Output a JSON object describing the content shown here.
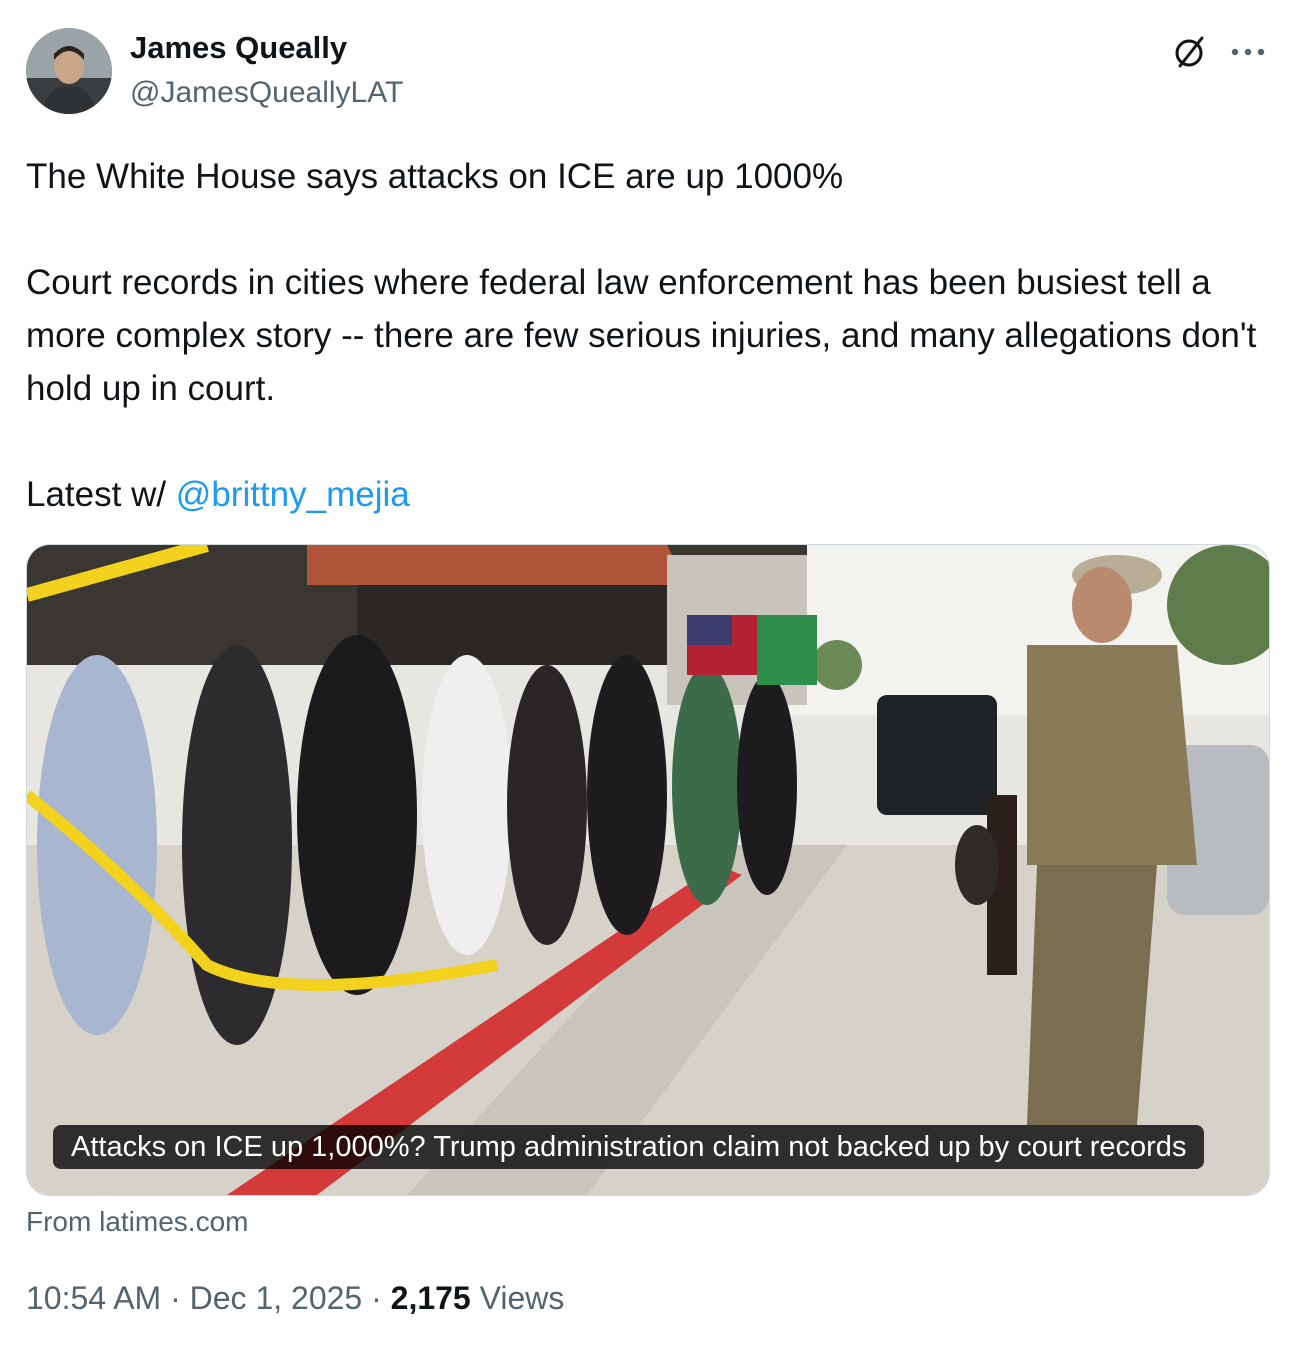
{
  "author": {
    "name": "James Queally",
    "handle": "@JamesQueallyLAT",
    "avatar_icon": "avatar-photo"
  },
  "header_icons": [
    "grok-icon",
    "more-icon"
  ],
  "tweet": {
    "line1": "The White House says attacks on ICE are up 1000%",
    "line2": "Court records in cities where federal law enforcement has been busiest tell a more complex story -- there are few serious injuries, and many allegations don't hold up in court.",
    "line3_prefix": "Latest w/ ",
    "mention": "@brittny_mejia"
  },
  "card": {
    "caption": "Attacks on ICE up 1,000%? Trump administration claim not backed up by court records",
    "source": "From latimes.com"
  },
  "meta": {
    "time": "10:54 AM",
    "separator": "·",
    "date": "Dec 1, 2025",
    "views_count": "2,175",
    "views_label": "Views"
  },
  "colors": {
    "text": "#0f1419",
    "secondary": "#536471",
    "link": "#1d9bf0"
  }
}
